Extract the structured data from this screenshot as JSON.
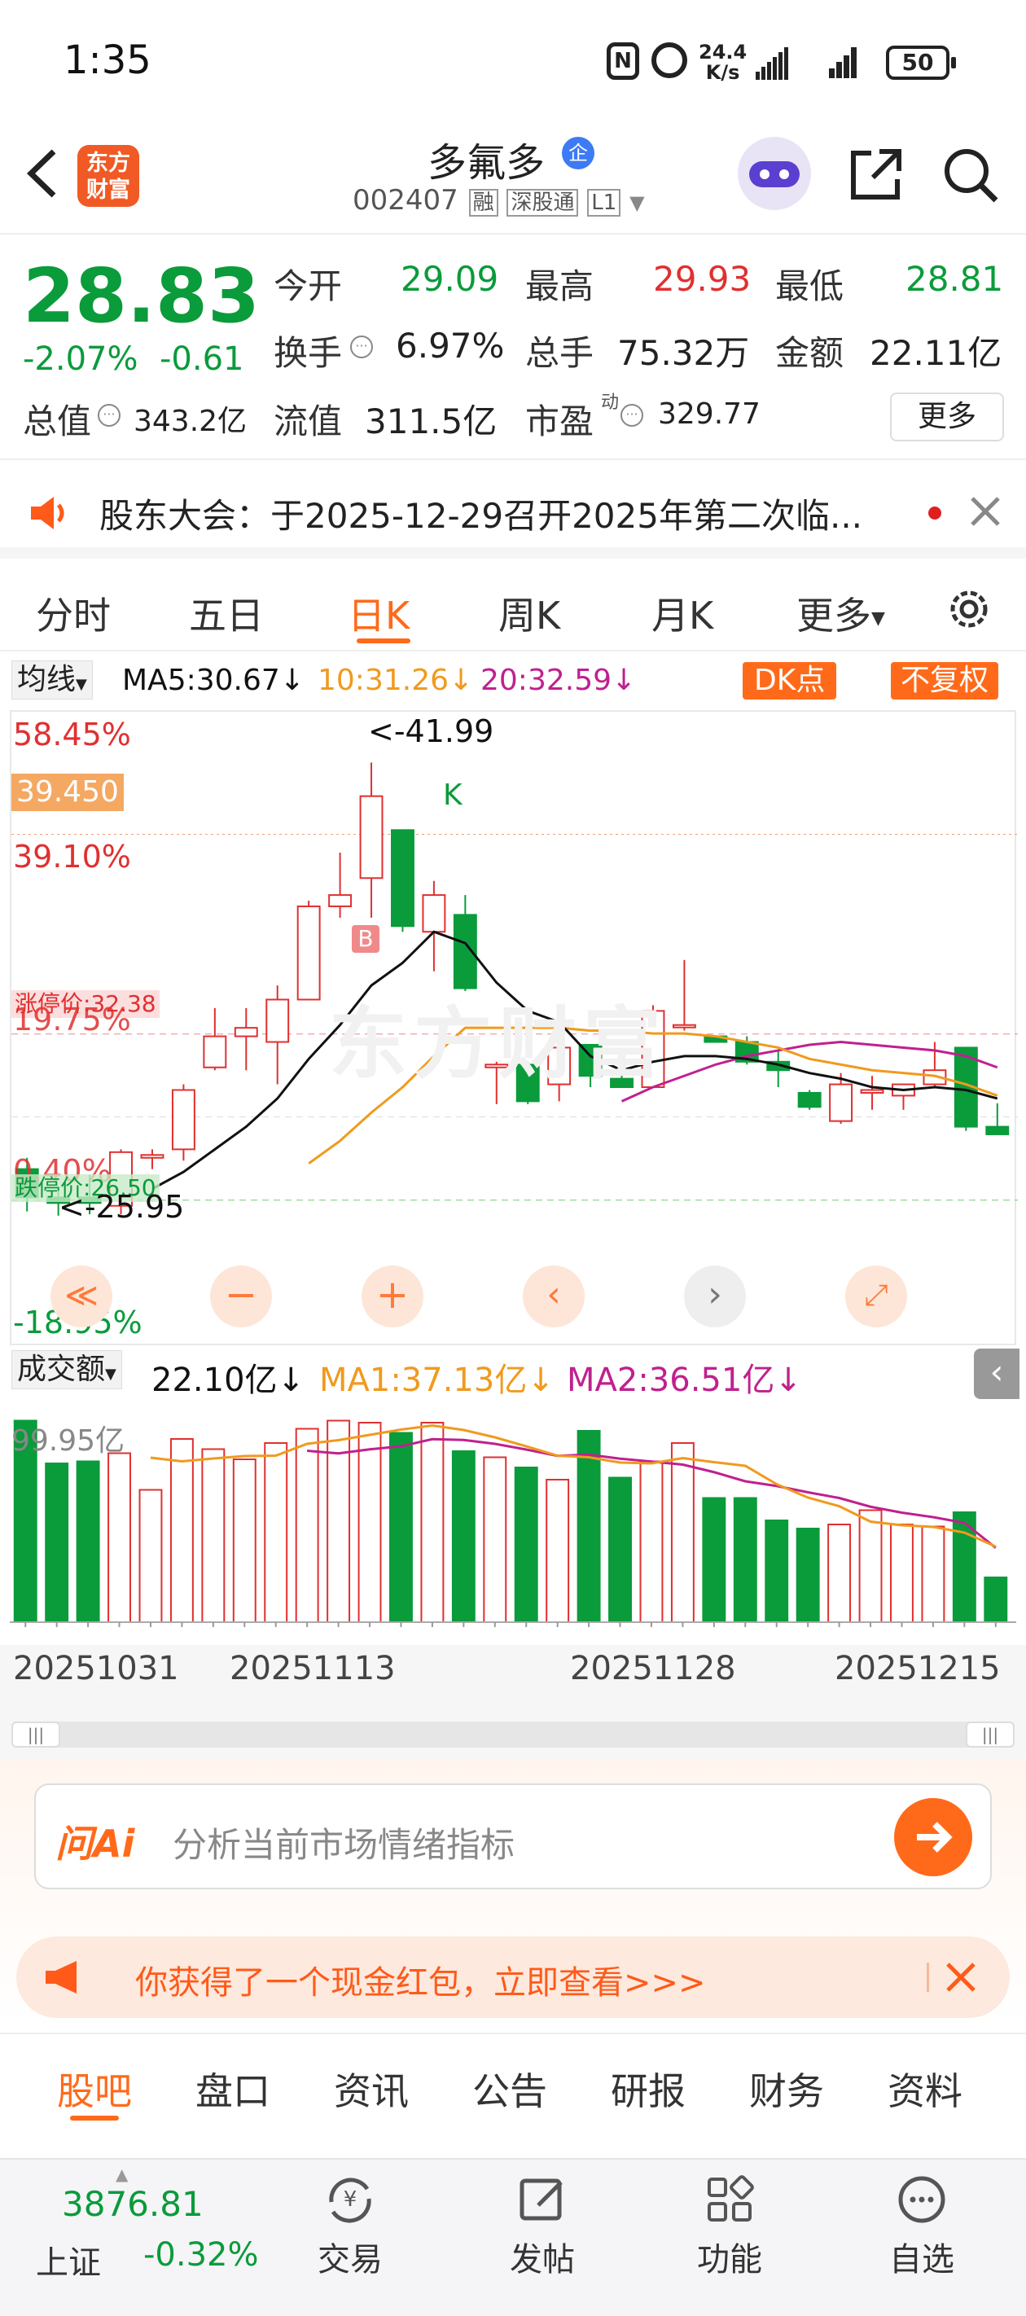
{
  "status": {
    "time": "1:35",
    "net_speed": "24.4",
    "net_unit": "K/s",
    "battery": "50"
  },
  "header": {
    "logo_line1": "东方",
    "logo_line2": "财富",
    "name": "多氟多",
    "badge": "企",
    "code": "002407",
    "tags": [
      "融",
      "深股通",
      "L1"
    ]
  },
  "quote": {
    "price": "28.83",
    "change_pct": "-2.07%",
    "change": "-0.61",
    "open_label": "今开",
    "open": "29.09",
    "high_label": "最高",
    "high": "29.93",
    "low_label": "最低",
    "low": "28.81",
    "turnover_label": "换手",
    "turnover": "6.97%",
    "volume_label": "总手",
    "volume": "75.32万",
    "amount_label": "金额",
    "amount": "22.11亿",
    "mcap_label": "总值",
    "mcap": "343.2亿",
    "float_label": "流值",
    "float": "311.5亿",
    "pe_label": "市盈",
    "pe_sup": "动",
    "pe": "329.77",
    "more": "更多"
  },
  "notice": {
    "text": "股东大会：于2025-12-29召开2025年第二次临..."
  },
  "chart_tabs": [
    "分时",
    "五日",
    "日K",
    "周K",
    "月K",
    "更多"
  ],
  "active_tab": "日K",
  "ma_row": {
    "select": "均线",
    "ma5": "MA5:30.67↓",
    "ma10": "10:31.26↓",
    "ma20": "20:32.59↓",
    "dk": "DK点",
    "fq": "不复权"
  },
  "chart_labels": {
    "top_pct": "58.45%",
    "price_tag": "39.450",
    "p2": "39.10%",
    "p3": "19.75%",
    "limit_up": "涨停价:32.38",
    "p4": "0.40%",
    "limit_down": "跌停价:26.50",
    "bottom_pct": "-18.95%",
    "high_note": "<-41.99",
    "low_note": "<-25.95",
    "k_mark": "K",
    "b_mark": "B",
    "watermark": "东方财富"
  },
  "vol_row": {
    "select": "成交额",
    "vol": "22.10亿↓",
    "ma1": "MA1:37.13亿↓",
    "ma2": "MA2:36.51亿↓",
    "max": "99.95亿"
  },
  "dates": [
    "20251031",
    "20251113",
    "20251128",
    "20251215"
  ],
  "ai": {
    "logo": "问Ai",
    "placeholder": "分析当前市场情绪指标"
  },
  "promo": {
    "text": "你获得了一个现金红包，立即查看>>>"
  },
  "bottom_tabs": [
    "股吧",
    "盘口",
    "资讯",
    "公告",
    "研报",
    "财务",
    "资料"
  ],
  "active_bottom": "股吧",
  "nav": {
    "index_value": "3876.81",
    "index_name": "上证",
    "index_change": "-0.32%",
    "items": [
      "交易",
      "发帖",
      "功能",
      "自选"
    ]
  },
  "colors": {
    "up": "#e03030",
    "down": "#0a9b3b",
    "accent": "#ff6a1a",
    "ma5": "#111111",
    "ma10": "#f09a1e",
    "ma20": "#c0208f"
  },
  "chart_data": {
    "type": "candlestick",
    "candles": [
      {
        "o": 27.6,
        "h": 28.0,
        "l": 26.1,
        "c": 26.6
      },
      {
        "o": 26.6,
        "h": 26.9,
        "l": 25.95,
        "c": 26.4
      },
      {
        "o": 26.6,
        "h": 27.4,
        "l": 26.0,
        "c": 26.4
      },
      {
        "o": 26.3,
        "h": 28.3,
        "l": 26.0,
        "c": 28.2
      },
      {
        "o": 28.0,
        "h": 28.3,
        "l": 27.6,
        "c": 28.1
      },
      {
        "o": 28.3,
        "h": 30.6,
        "l": 27.9,
        "c": 30.4
      },
      {
        "o": 31.2,
        "h": 33.3,
        "l": 31.1,
        "c": 32.3
      },
      {
        "o": 32.3,
        "h": 33.3,
        "l": 31.1,
        "c": 32.6
      },
      {
        "o": 32.1,
        "h": 34.1,
        "l": 30.6,
        "c": 33.6
      },
      {
        "o": 33.6,
        "h": 37.1,
        "l": 33.6,
        "c": 36.9
      },
      {
        "o": 36.9,
        "h": 38.8,
        "l": 36.5,
        "c": 37.3
      },
      {
        "o": 37.9,
        "h": 41.99,
        "l": 36.5,
        "c": 40.8
      },
      {
        "o": 39.6,
        "h": 39.6,
        "l": 36.0,
        "c": 36.2
      },
      {
        "o": 36.0,
        "h": 37.8,
        "l": 34.6,
        "c": 37.3
      },
      {
        "o": 36.6,
        "h": 37.3,
        "l": 33.9,
        "c": 34.0
      },
      {
        "o": 31.2,
        "h": 31.4,
        "l": 29.9,
        "c": 31.3
      },
      {
        "o": 31.3,
        "h": 31.4,
        "l": 29.9,
        "c": 30.0
      },
      {
        "o": 30.6,
        "h": 31.9,
        "l": 30.0,
        "c": 31.9
      },
      {
        "o": 32.0,
        "h": 32.0,
        "l": 30.5,
        "c": 30.9
      },
      {
        "o": 30.8,
        "h": 31.7,
        "l": 30.5,
        "c": 30.5
      },
      {
        "o": 30.5,
        "h": 33.4,
        "l": 30.5,
        "c": 33.2
      },
      {
        "o": 32.7,
        "h": 35.0,
        "l": 32.5,
        "c": 32.7
      },
      {
        "o": 32.3,
        "h": 32.3,
        "l": 32.1,
        "c": 32.1
      },
      {
        "o": 32.1,
        "h": 32.3,
        "l": 31.3,
        "c": 31.4
      },
      {
        "o": 31.4,
        "h": 31.8,
        "l": 30.5,
        "c": 31.1
      },
      {
        "o": 30.3,
        "h": 30.4,
        "l": 29.7,
        "c": 29.8
      },
      {
        "o": 29.3,
        "h": 31.0,
        "l": 29.2,
        "c": 30.6
      },
      {
        "o": 30.3,
        "h": 30.9,
        "l": 29.7,
        "c": 30.4
      },
      {
        "o": 30.2,
        "h": 30.6,
        "l": 29.7,
        "c": 30.6
      },
      {
        "o": 30.6,
        "h": 32.1,
        "l": 30.5,
        "c": 31.1
      },
      {
        "o": 31.9,
        "h": 31.9,
        "l": 28.95,
        "c": 29.1
      },
      {
        "o": 29.1,
        "h": 29.93,
        "l": 28.81,
        "c": 28.83
      }
    ],
    "ma5": [
      null,
      null,
      null,
      null,
      26.9,
      27.5,
      28.3,
      29.1,
      30.1,
      31.5,
      32.7,
      34.1,
      34.9,
      36.0,
      35.6,
      34.2,
      33.2,
      32.8,
      31.6,
      31.1,
      31.4,
      31.6,
      31.6,
      31.5,
      31.3,
      31.0,
      30.8,
      30.5,
      30.4,
      30.5,
      30.4,
      30.1
    ],
    "ma10": [
      null,
      null,
      null,
      null,
      null,
      null,
      null,
      null,
      null,
      27.8,
      28.6,
      29.6,
      30.5,
      31.6,
      32.6,
      32.6,
      32.6,
      32.6,
      32.5,
      32.5,
      32.4,
      32.4,
      32.3,
      32.1,
      31.9,
      31.5,
      31.3,
      31.1,
      31.0,
      30.9,
      30.6,
      30.2
    ],
    "ma20": [
      null,
      null,
      null,
      null,
      null,
      null,
      null,
      null,
      null,
      null,
      null,
      null,
      null,
      null,
      null,
      null,
      null,
      null,
      null,
      30.0,
      30.5,
      30.9,
      31.3,
      31.6,
      31.8,
      32.0,
      32.1,
      32.0,
      31.9,
      31.8,
      31.6,
      31.2
    ],
    "volume": [
      99,
      78,
      79,
      83,
      65,
      90,
      85,
      80,
      88,
      95,
      99,
      98,
      93,
      98,
      84,
      81,
      76,
      70,
      94,
      71,
      79,
      88,
      61,
      61,
      50,
      46,
      48,
      55,
      48,
      47,
      54,
      22
    ],
    "volume_ma1": [
      null,
      null,
      null,
      null,
      80.8,
      79.0,
      80.4,
      81.6,
      81.8,
      87.6,
      89.4,
      92.0,
      94.6,
      96.6,
      94.4,
      90.8,
      86.4,
      81.8,
      81.0,
      78.4,
      78.0,
      80.6,
      78.6,
      76.8,
      67.8,
      61.2,
      57.0,
      49.4,
      47.6,
      46.8,
      44.0,
      37.13
    ],
    "volume_ma2": [
      null,
      null,
      null,
      null,
      null,
      null,
      null,
      null,
      null,
      84.2,
      82.9,
      84.9,
      86.4,
      89.9,
      89.5,
      87.6,
      84.8,
      81.7,
      82.3,
      80.3,
      78.9,
      77.4,
      73.7,
      69.2,
      66.9,
      63.8,
      61.0,
      56.7,
      53.8,
      51.6,
      48.8,
      36.51
    ],
    "axis": {
      "price_min": 23.9,
      "price_max": 43.5,
      "volume_max_label": "99.95亿"
    },
    "x_tick_labels": [
      "20251031",
      "20251113",
      "20251128",
      "20251215"
    ]
  }
}
